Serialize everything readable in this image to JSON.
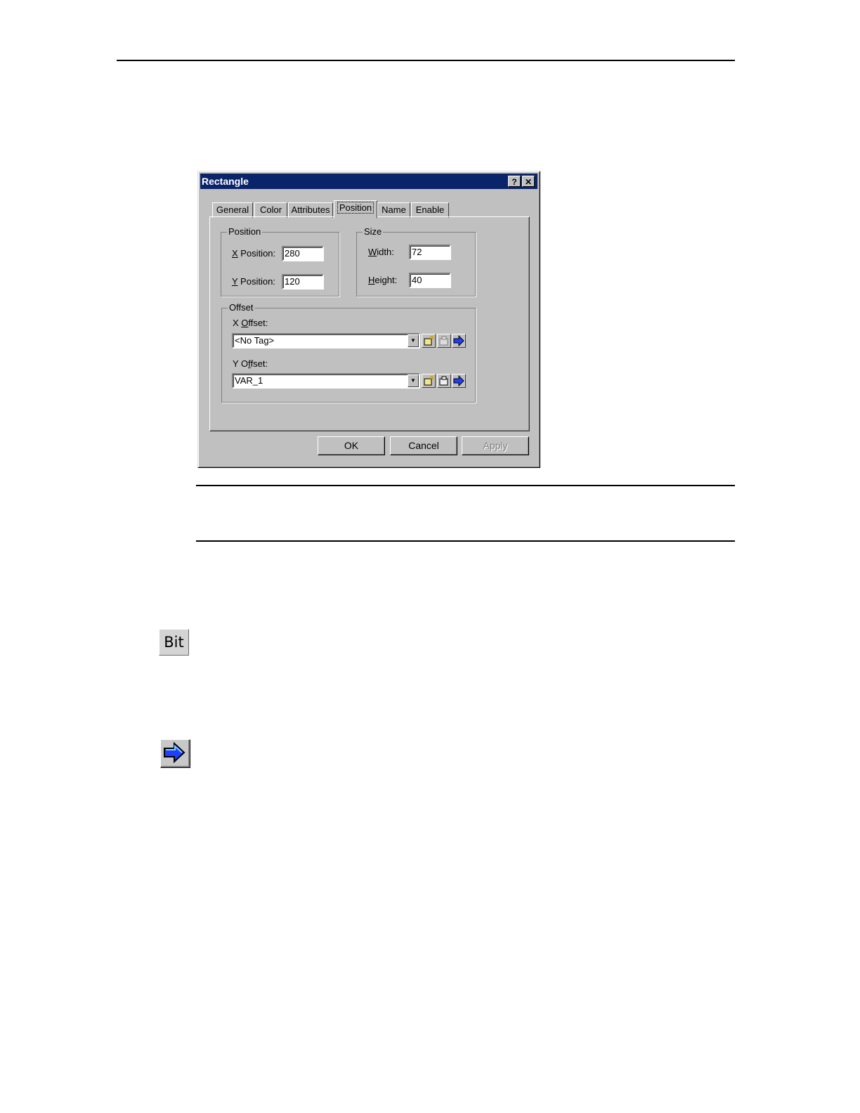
{
  "dialog": {
    "title": "Rectangle",
    "help_glyph": "?",
    "close_glyph": "✕",
    "tabs": [
      {
        "label": "General"
      },
      {
        "label": "Color"
      },
      {
        "label": "Attributes"
      },
      {
        "label": "Position",
        "active": true
      },
      {
        "label": "Name"
      },
      {
        "label": "Enable"
      }
    ],
    "position_group": {
      "label": "Position",
      "x_mnemonic": "X",
      "x_label_rest": " Position:",
      "x_value": "280",
      "y_mnemonic": "Y",
      "y_label_rest": " Position:",
      "y_value": "120"
    },
    "size_group": {
      "label": "Size",
      "width_mnemonic": "W",
      "width_label_rest": "idth:",
      "width_value": "72",
      "height_mnemonic": "H",
      "height_label_rest": "eight:",
      "height_value": "40"
    },
    "offset_group": {
      "label": "Offset",
      "x_label_pre": "X ",
      "x_mnemonic": "O",
      "x_label_rest": "ffset:",
      "x_value": "<No Tag>",
      "y_label_pre": "Y O",
      "y_mnemonic": "f",
      "y_label_rest": "fset:",
      "y_value": "VAR_1"
    },
    "buttons": {
      "ok": "OK",
      "cancel": "Cancel",
      "apply": "Apply"
    }
  },
  "toolbar_icons": {
    "bit_label": "Bit"
  },
  "colors": {
    "titlebar": "#0a246a",
    "face": "#c0c0c0",
    "arrow": "#1f3fff"
  }
}
